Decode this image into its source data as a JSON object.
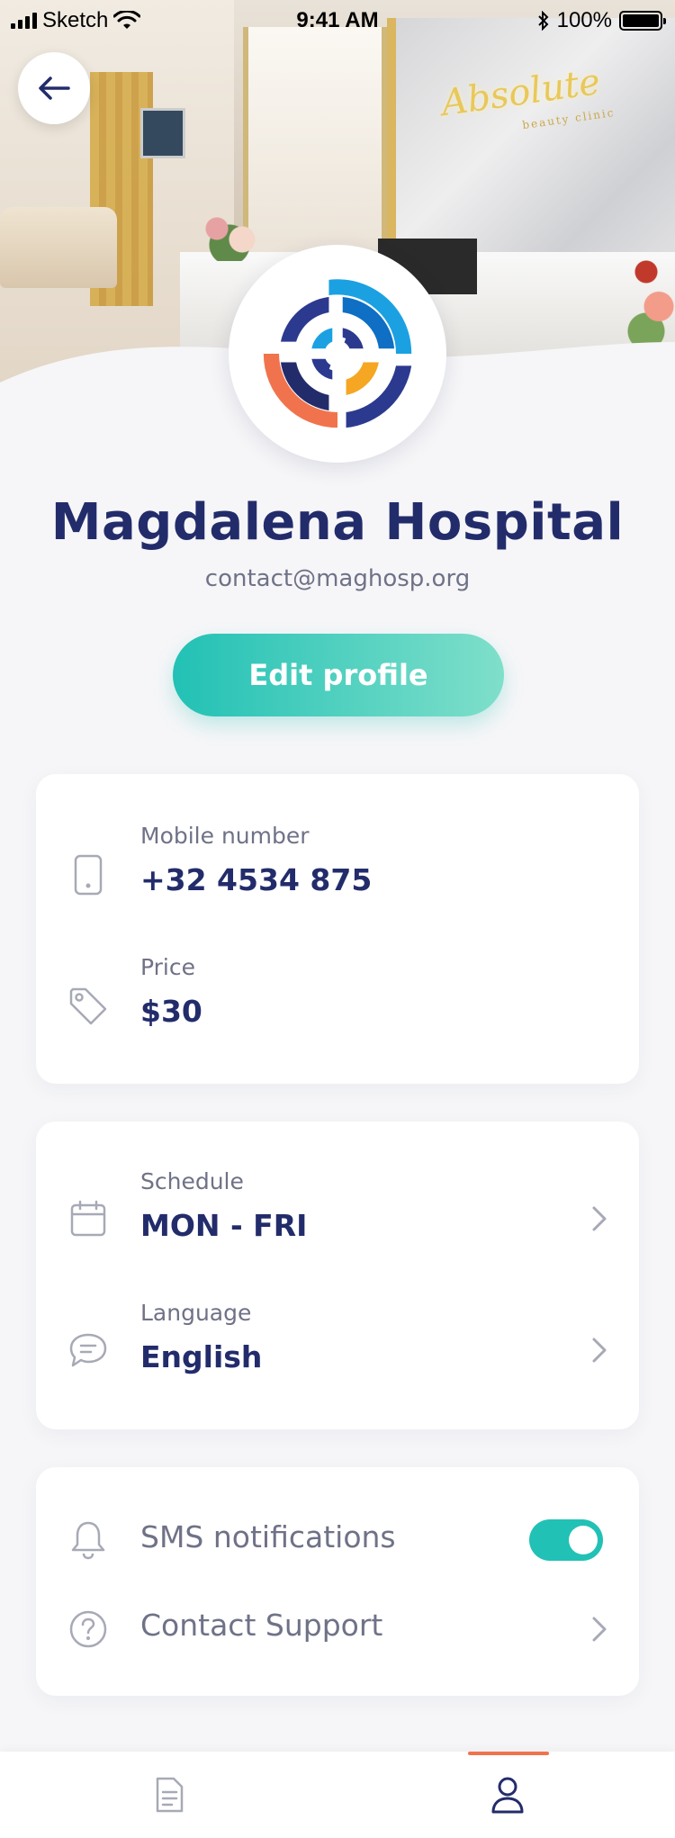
{
  "status_bar": {
    "carrier": "Sketch",
    "time": "9:41 AM",
    "battery": "100%"
  },
  "hero": {
    "sign_text": "Absolute",
    "sign_subtext": "beauty clinic"
  },
  "profile": {
    "name": "Magdalena Hospital",
    "email": "contact@maghosp.org",
    "edit_label": "Edit profile"
  },
  "contact_card": {
    "mobile_label": "Mobile number",
    "mobile_value": "+32 4534 875",
    "price_label": "Price",
    "price_value": "$30"
  },
  "info_card": {
    "schedule_label": "Schedule",
    "schedule_value": "MON - FRI",
    "language_label": "Language",
    "language_value": "English"
  },
  "settings_card": {
    "sms_label": "SMS notifications",
    "sms_enabled": true,
    "support_label": "Contact Support"
  },
  "colors": {
    "primary_text": "#232c6b",
    "secondary_text": "#6f7287",
    "accent_teal": "#22c1b5",
    "tab_indicator": "#f1734d"
  },
  "icons": {
    "back": "arrow-left-icon",
    "mobile": "phone-icon",
    "price": "tag-icon",
    "schedule": "calendar-icon",
    "language": "chat-bubble-icon",
    "sms": "bell-icon",
    "support": "question-circle-icon",
    "tab_docs": "document-icon",
    "tab_profile": "user-icon"
  }
}
